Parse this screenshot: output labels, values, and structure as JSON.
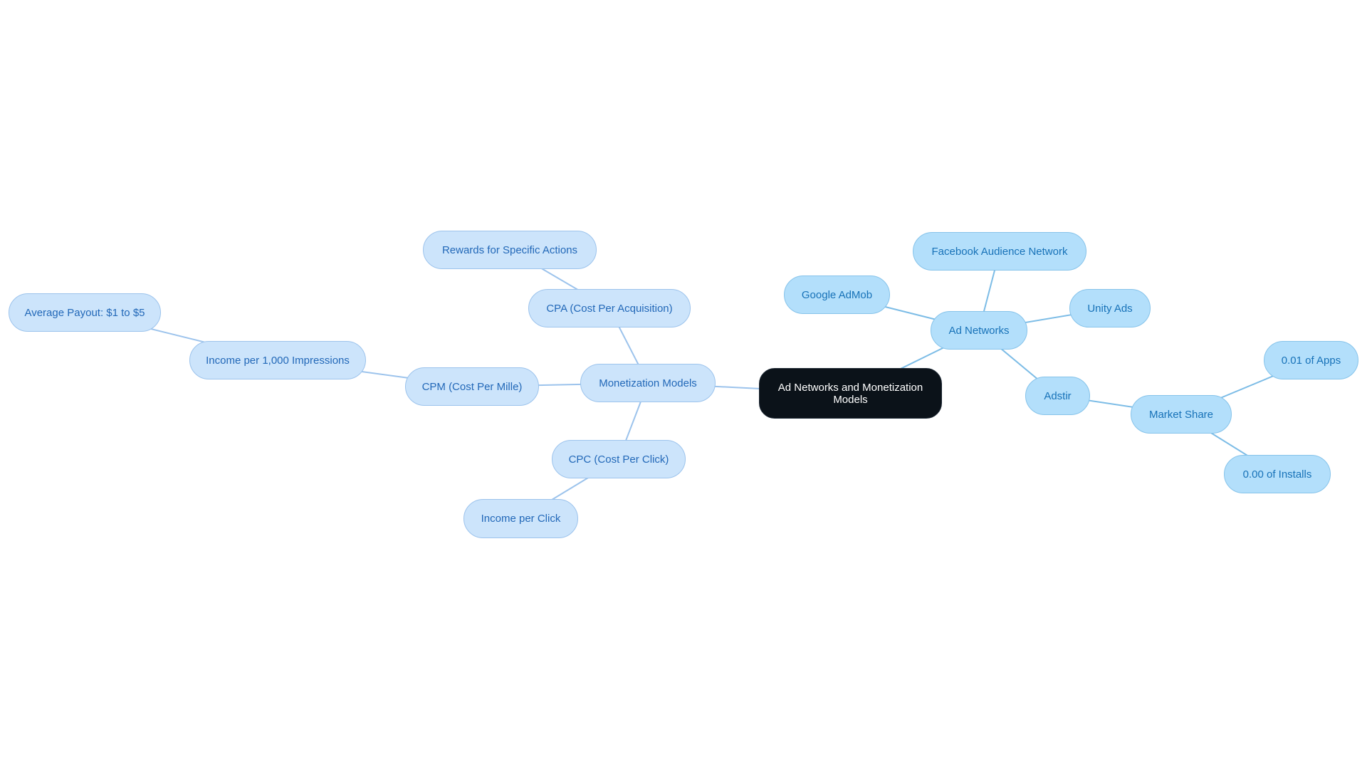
{
  "diagram": {
    "type": "mind-map",
    "colors": {
      "root_fill": "#0b1219",
      "root_text": "#ffffff",
      "left_fill": "#cce4fb",
      "left_border": "#9cc3ec",
      "left_text": "#2268b8",
      "left_edge": "#9cc3ec",
      "right_fill": "#b3dffb",
      "right_border": "#86c3ea",
      "right_text": "#1772b8",
      "right_edge": "#7cbce6"
    },
    "root": {
      "id": "root",
      "label": "Ad Networks and Monetization Models"
    },
    "nodes": [
      {
        "id": "monetization-models",
        "label": "Monetization Models",
        "parent": "root",
        "branch": "left"
      },
      {
        "id": "cpa",
        "label": "CPA (Cost Per Acquisition)",
        "parent": "monetization-models",
        "branch": "left"
      },
      {
        "id": "rewards",
        "label": "Rewards for Specific Actions",
        "parent": "cpa",
        "branch": "left"
      },
      {
        "id": "cpm",
        "label": "CPM (Cost Per Mille)",
        "parent": "monetization-models",
        "branch": "left"
      },
      {
        "id": "income-1000",
        "label": "Income per 1,000 Impressions",
        "parent": "cpm",
        "branch": "left"
      },
      {
        "id": "avg-payout",
        "label": "Average Payout: $1 to $5",
        "parent": "income-1000",
        "branch": "left"
      },
      {
        "id": "cpc",
        "label": "CPC (Cost Per Click)",
        "parent": "monetization-models",
        "branch": "left"
      },
      {
        "id": "income-click",
        "label": "Income per Click",
        "parent": "cpc",
        "branch": "left"
      },
      {
        "id": "ad-networks",
        "label": "Ad Networks",
        "parent": "root",
        "branch": "right"
      },
      {
        "id": "google-admob",
        "label": "Google AdMob",
        "parent": "ad-networks",
        "branch": "right"
      },
      {
        "id": "facebook-an",
        "label": "Facebook Audience Network",
        "parent": "ad-networks",
        "branch": "right"
      },
      {
        "id": "unity-ads",
        "label": "Unity Ads",
        "parent": "ad-networks",
        "branch": "right"
      },
      {
        "id": "adstir",
        "label": "Adstir",
        "parent": "ad-networks",
        "branch": "right"
      },
      {
        "id": "market-share",
        "label": "Market Share",
        "parent": "adstir",
        "branch": "right"
      },
      {
        "id": "apps-share",
        "label": "0.01 of Apps",
        "parent": "market-share",
        "branch": "right"
      },
      {
        "id": "installs-share",
        "label": "0.00 of Installs",
        "parent": "market-share",
        "branch": "right"
      }
    ]
  }
}
